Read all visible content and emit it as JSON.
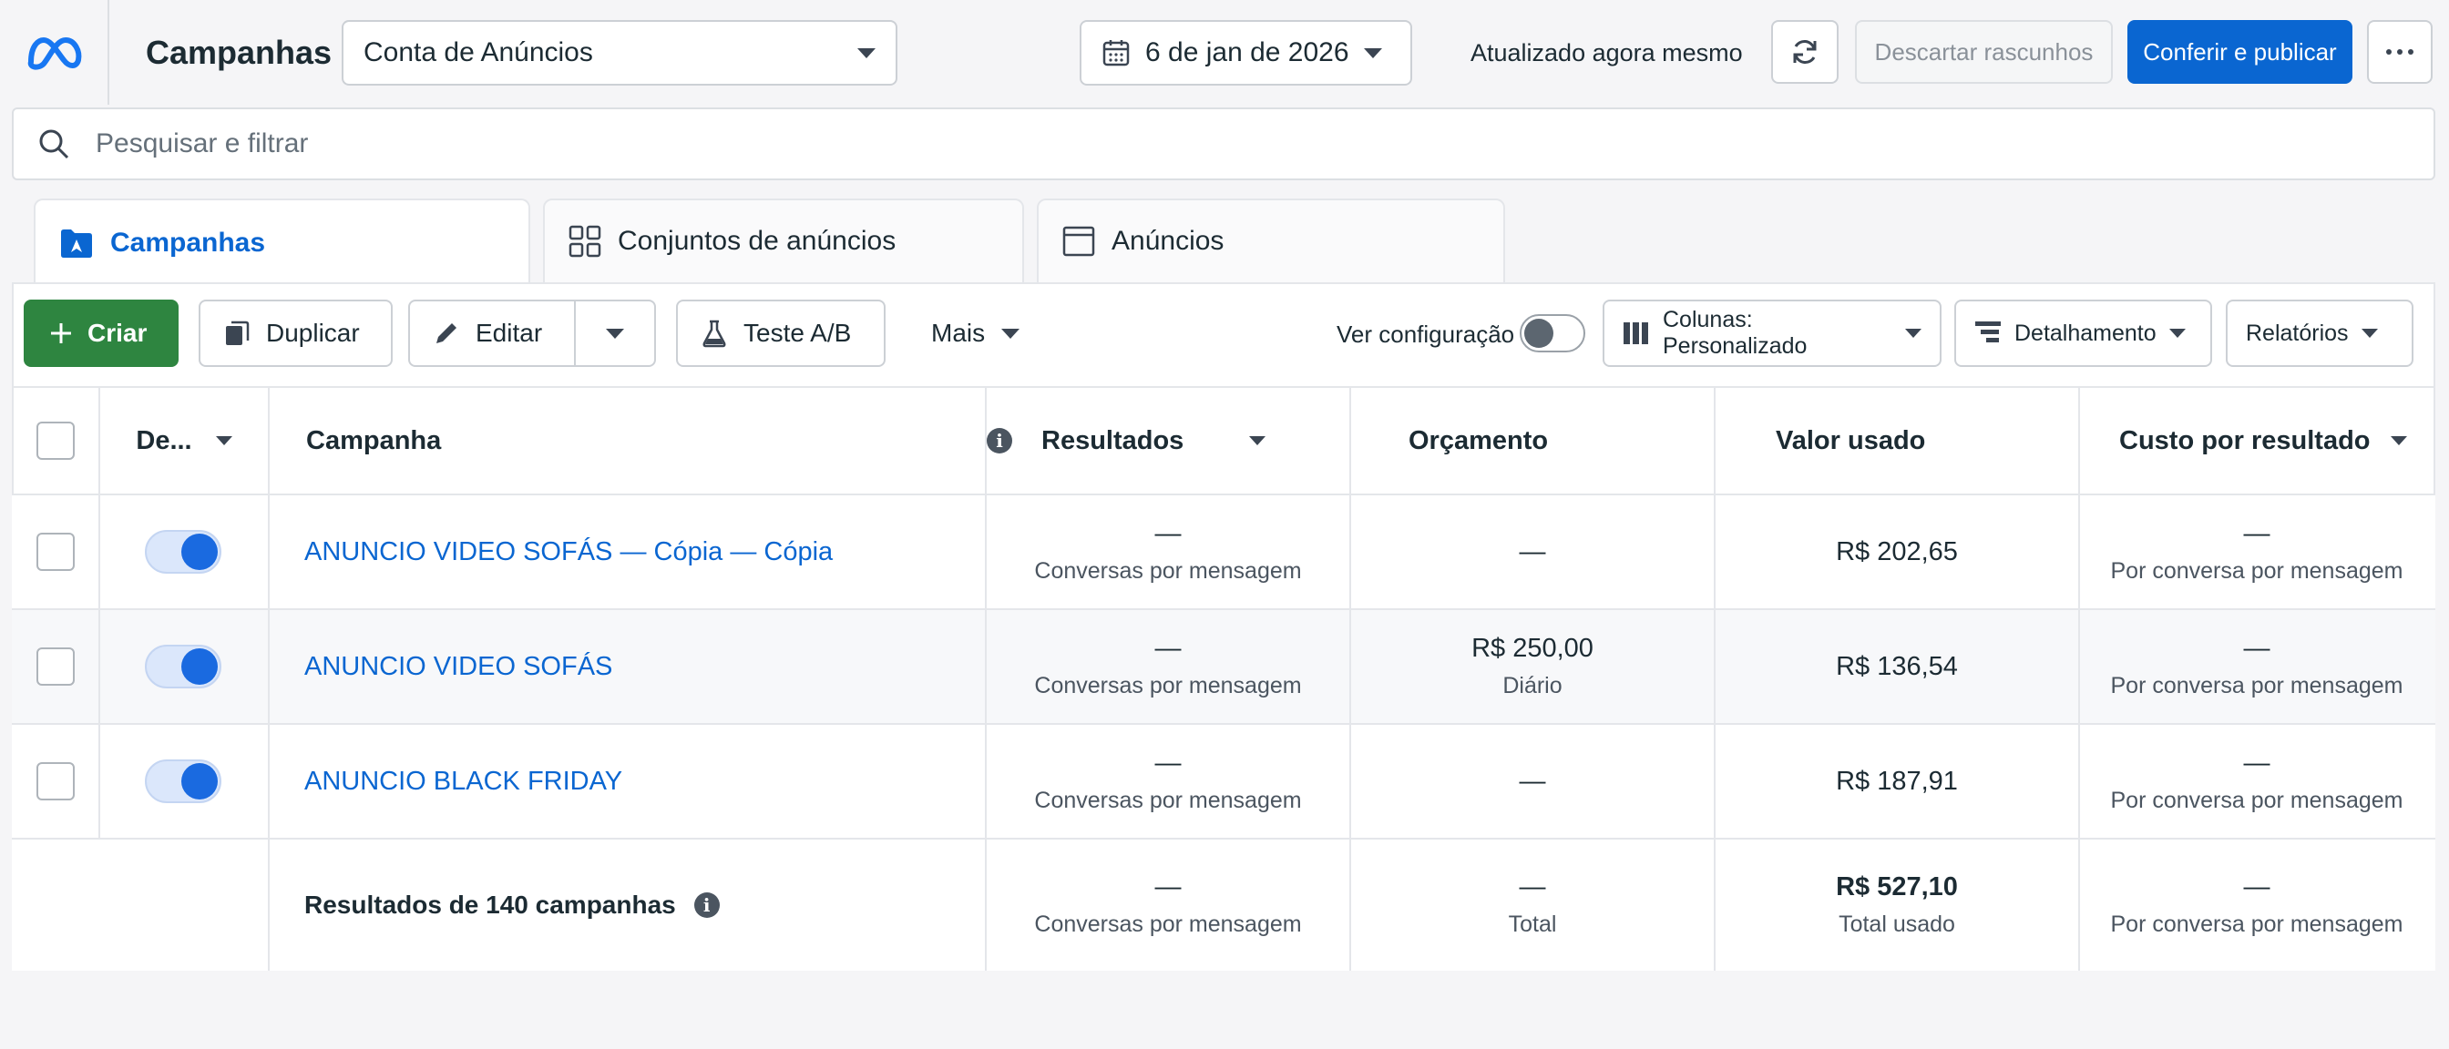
{
  "header": {
    "title": "Campanhas",
    "account": "Conta de Anúncios",
    "date": "6 de jan de 2026",
    "updated": "Atualizado agora mesmo",
    "discard_label": "Descartar rascunhos",
    "publish_label": "Conferir e publicar"
  },
  "search": {
    "placeholder": "Pesquisar e filtrar"
  },
  "tabs": [
    {
      "label": "Campanhas",
      "active": true
    },
    {
      "label": "Conjuntos de anúncios"
    },
    {
      "label": "Anúncios"
    }
  ],
  "toolbar": {
    "create": "Criar",
    "duplicate": "Duplicar",
    "edit": "Editar",
    "ab_test": "Teste A/B",
    "more": "Mais",
    "view_config": "Ver configuração",
    "columns": "Colunas: Personalizado",
    "breakdown": "Detalhamento",
    "reports": "Relatórios"
  },
  "table": {
    "headers": {
      "delivery": "De...",
      "campaign": "Campanha",
      "results": "Resultados",
      "budget": "Orçamento",
      "spent": "Valor usado",
      "cost": "Custo por resultado"
    },
    "rows": [
      {
        "name": "ANUNCIO VIDEO SOFÁS — Cópia — Cópia",
        "results": "—",
        "results_sub": "Conversas por mensagem",
        "budget": "—",
        "budget_sub": "",
        "spent": "R$ 202,65",
        "cost": "—",
        "cost_sub": "Por conversa por mensagem",
        "active": true
      },
      {
        "name": "ANUNCIO VIDEO SOFÁS",
        "results": "—",
        "results_sub": "Conversas por mensagem",
        "budget": "R$ 250,00",
        "budget_sub": "Diário",
        "spent": "R$ 136,54",
        "cost": "—",
        "cost_sub": "Por conversa por mensagem",
        "active": true
      },
      {
        "name": "ANUNCIO BLACK FRIDAY",
        "results": "—",
        "results_sub": "Conversas por mensagem",
        "budget": "—",
        "budget_sub": "",
        "spent": "R$ 187,91",
        "cost": "—",
        "cost_sub": "Por conversa por mensagem",
        "active": true
      }
    ],
    "summary": {
      "label": "Resultados de 140 campanhas",
      "results": "—",
      "results_sub": "Conversas por mensagem",
      "budget": "—",
      "budget_sub": "Total",
      "spent": "R$ 527,10",
      "spent_sub": "Total usado",
      "cost": "—",
      "cost_sub": "Por conversa por mensagem"
    }
  },
  "colors": {
    "brand_blue": "#0a66d1",
    "create_green": "#2e8540",
    "toggle_blue": "#1a6ae0"
  }
}
